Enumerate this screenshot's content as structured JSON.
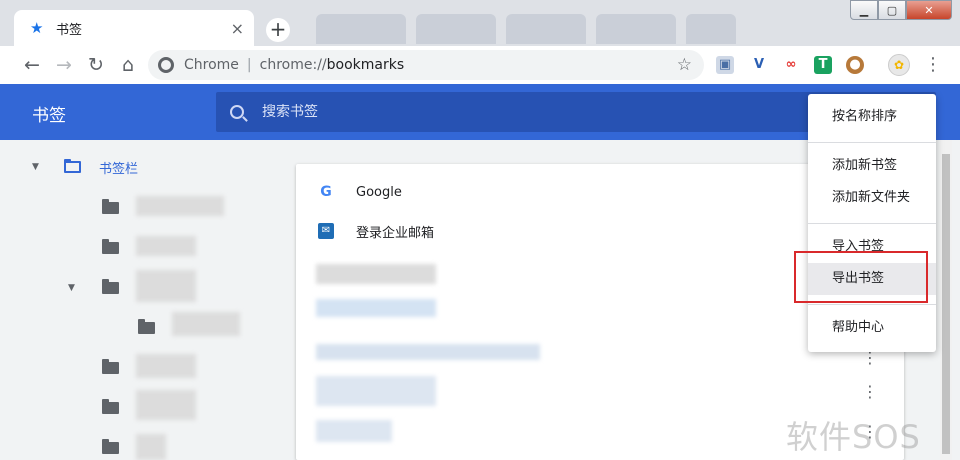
{
  "tab": {
    "title": "书签",
    "close": "×"
  },
  "toolbar": {
    "origin_label": "Chrome",
    "url_scheme": "chrome://",
    "url_path": "bookmarks"
  },
  "header": {
    "title": "书签",
    "search_placeholder": "搜索书签"
  },
  "sidebar": {
    "bookmarks_bar_label": "书签栏"
  },
  "bookmarks": [
    {
      "title": "Google",
      "icon": "google-icon"
    },
    {
      "title": "登录企业邮箱",
      "icon": "mail-icon"
    }
  ],
  "menu": {
    "sort_by_name": "按名称排序",
    "add_bookmark": "添加新书签",
    "add_folder": "添加新文件夹",
    "import": "导入书签",
    "export": "导出书签",
    "help": "帮助中心"
  },
  "colors": {
    "header_blue": "#3367d6",
    "highlight_red": "#d9292b"
  },
  "watermark": "软件SOS"
}
